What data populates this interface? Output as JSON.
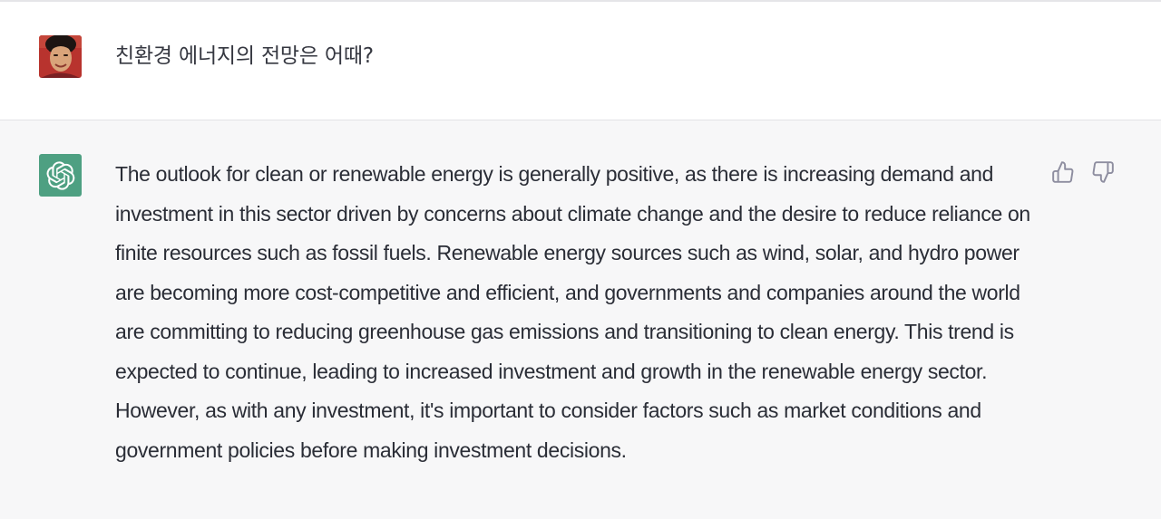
{
  "conversation": {
    "user_message": {
      "avatar": "user-photo-avatar",
      "text": "친환경 에너지의 전망은 어때?"
    },
    "assistant_message": {
      "avatar": "openai-logo-icon",
      "avatar_color": "#4ea082",
      "text": "The outlook for clean or renewable energy is generally positive, as there is increasing demand and investment in this sector driven by concerns about climate change and the desire to reduce reliance on finite resources such as fossil fuels. Renewable energy sources such as wind, solar, and hydro power are becoming more cost-competitive and efficient, and governments and companies around the world are committing to reducing greenhouse gas emissions and transitioning to clean energy. This trend is expected to continue, leading to increased investment and growth in the renewable energy sector. However, as with any investment, it's important to consider factors such as market conditions and government policies before making investment decisions.",
      "feedback_icons": [
        "thumbs-up-icon",
        "thumbs-down-icon"
      ]
    }
  },
  "colors": {
    "user_row_bg": "#ffffff",
    "assistant_row_bg": "#f7f7f8",
    "text": "#2a2d36",
    "icon": "#8e8ea0"
  }
}
